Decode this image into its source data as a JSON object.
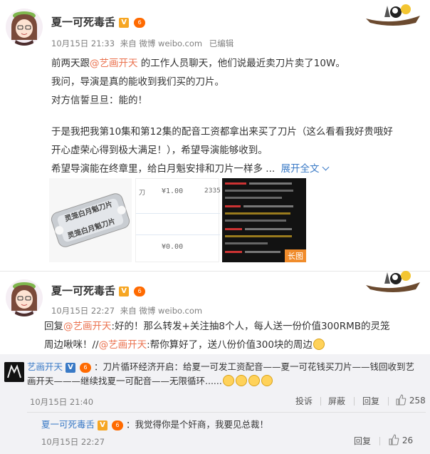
{
  "post1": {
    "user": "夏一可死毒舌",
    "timestamp": "10月15日 21:33",
    "source": "来自 微博 weibo.com",
    "edited": "已编辑",
    "line1_pre": "前两天跟",
    "line1_mention": "@艺画开天",
    "line1_post": " 的工作人员聊天，他们说最近卖刀片卖了10W。",
    "line2": "我问，导演是真的能收到我们买的刀片。",
    "line3": "对方信誓旦旦：能的！",
    "line4": "于是我把我第10集和第12集的配音工资都拿出来买了刀片（这么看看我好贵哦好",
    "line5": "开心虚荣心得到极大满足！），希望导演能够收到。",
    "line6": "希望导演能在终章里，给白月魁安排和刀片一样多 ...",
    "expand": "展开全文",
    "images": {
      "blade_text_1": "灵笼白月魁刀片",
      "blade_text_2": "灵笼白月魁刀片",
      "receipt_amount1": "¥1.00",
      "receipt_id": "2335",
      "receipt_mark": "刀",
      "receipt_amount2": "¥0.00",
      "long_image_label": "长图"
    }
  },
  "post2": {
    "user": "夏一可死毒舌",
    "timestamp": "10月15日 22:27",
    "source": "来自 微博 weibo.com",
    "line1_pre": "回复",
    "line1_mention": "@艺画开天",
    "line1_post": ":好的！那么转发+关注抽8个人，每人送一份价值300RMB的灵笼",
    "line2_pre": "周边啾咪！//",
    "line2_mention": "@艺画开天",
    "line2_post": ":帮你算好了，送八份价值300块的周边"
  },
  "comment1": {
    "user": "艺画开天",
    "text_line1": "：刀片循环经济开启：给夏一可发工资配音——夏一可花钱买刀片——钱回收到艺",
    "text_line2": "画开天———继续找夏一可配音——无限循环......",
    "timestamp": "10月15日 21:40",
    "actions": {
      "report": "投诉",
      "block": "屏蔽",
      "reply": "回复",
      "likes": "258"
    }
  },
  "comment2": {
    "user": "夏一可死毒舌",
    "text": "：我觉得你是个奸商，我要见总裁！",
    "timestamp": "10月15日 22:27",
    "actions": {
      "reply": "回复",
      "likes": "26"
    }
  },
  "badges": {
    "v": "V",
    "vip": "6"
  }
}
